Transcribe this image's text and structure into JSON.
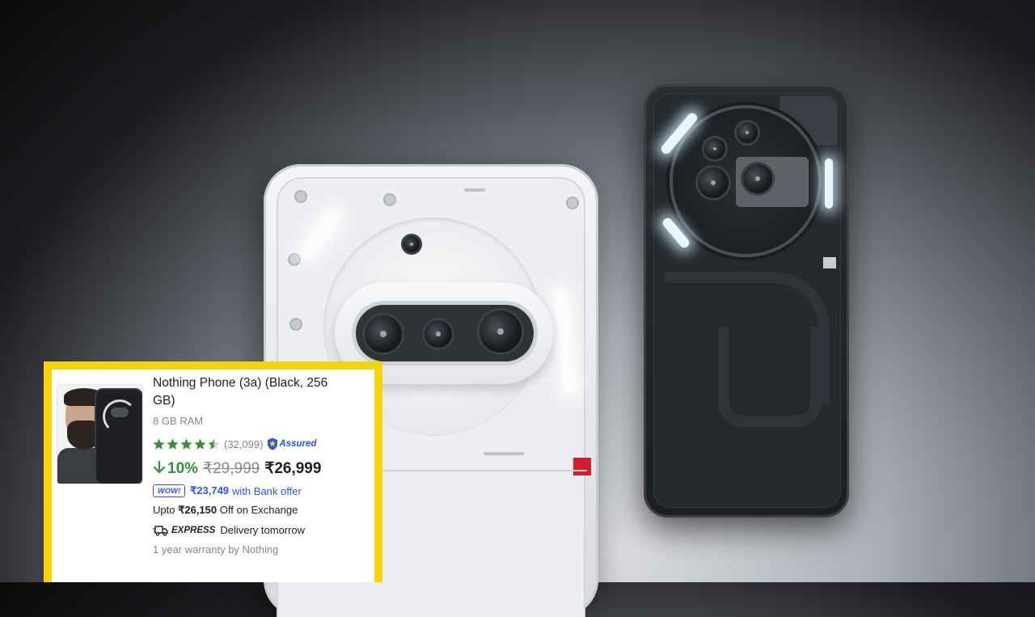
{
  "product": {
    "title": "Nothing Phone (3a) (Black, 256 GB)",
    "ram": "8 GB RAM",
    "rating_stars": 4.5,
    "review_count": "(32,099)",
    "assured_label": "Assured",
    "discount": "10%",
    "mrp": "₹29,999",
    "price": "₹26,999",
    "bank_badge": "WOW!",
    "bank_price": "₹23,749",
    "bank_text": "with Bank offer",
    "exchange_prefix": "Upto",
    "exchange_value": "₹26,150",
    "exchange_suffix": "Off on Exchange",
    "express_label": "EXPRESS",
    "delivery_text": "Delivery tomorrow",
    "warranty": "1 year warranty by Nothing"
  },
  "colors": {
    "frame": "#f6d608",
    "star_green": "#388e3c",
    "link_blue": "#2a55e5",
    "text_primary": "#212121",
    "text_secondary": "#878787"
  },
  "icons": [
    "arrow-down-icon",
    "star-icon",
    "assured-shield-icon",
    "wow-badge-icon",
    "truck-icon"
  ]
}
